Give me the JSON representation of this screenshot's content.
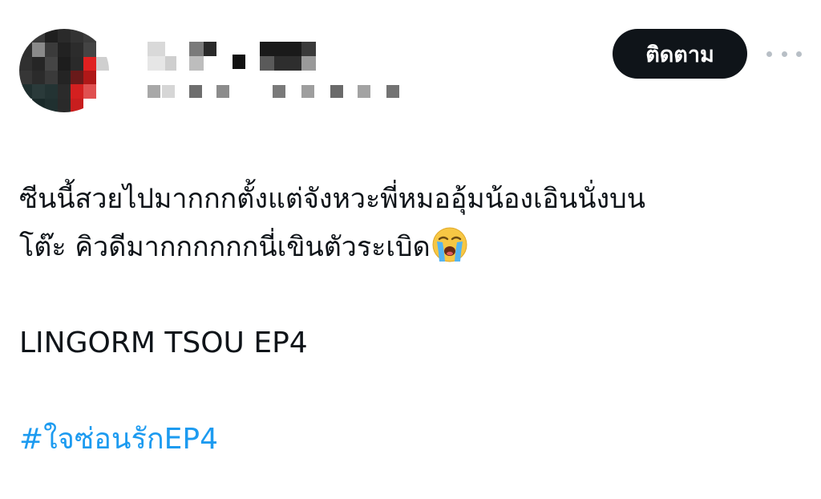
{
  "author": {
    "display_name": "",
    "handle": ""
  },
  "actions": {
    "follow_label": "ติดตาม",
    "more_icon": "more-horizontal-icon"
  },
  "tweet": {
    "line1": "ซีนนี้สวยไปมากกกตั้งแต่จังหวะพี่หมออุ้มน้องเอินนั่งบน",
    "line2": "โต๊ะ คิวดีมากกกกกกนี่เขินตัวระเบิด",
    "emoji": "loudly-crying-face-emoji",
    "line3": "LINGORM TSOU EP4",
    "hashtag": "#ใจซ่อนรักEP4"
  },
  "colors": {
    "text": "#0f1419",
    "hashtag": "#1d9bf0",
    "follow_bg": "#0f1419",
    "follow_text": "#ffffff",
    "more_dots": "#b8bfc6"
  }
}
